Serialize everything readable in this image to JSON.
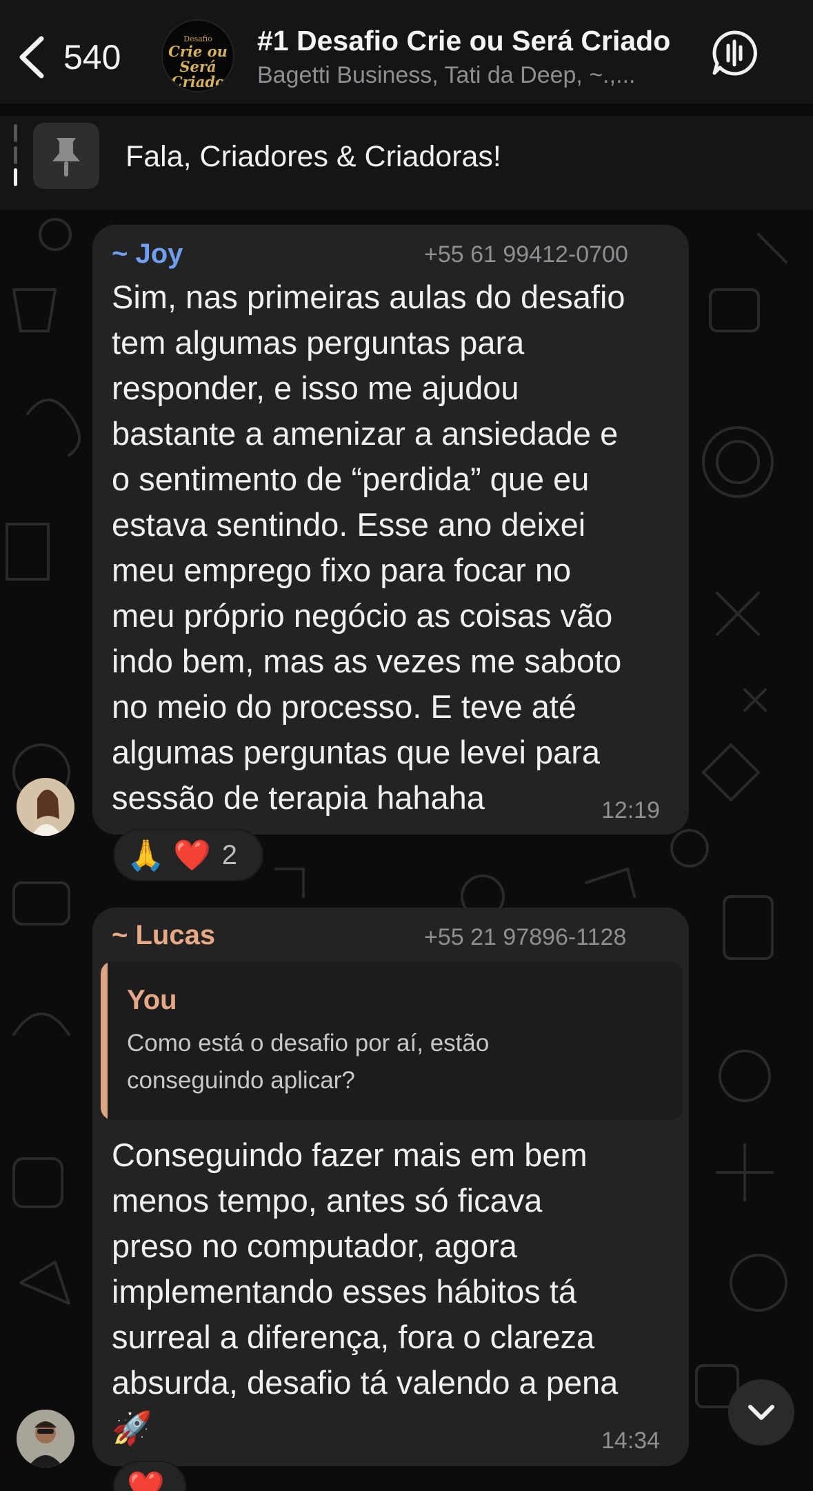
{
  "header": {
    "back_count": "540",
    "title": "#1 Desafio Crie ou Será Criado",
    "subtitle": "Bagetti Business, Tati da Deep, ~.,...",
    "avatar_logo_small": "Desafio",
    "avatar_logo_main": "Crie ou Será Criado"
  },
  "pinned": {
    "text": "Fala, Criadores & Criadoras!"
  },
  "messages": [
    {
      "sender": "~ Joy",
      "phone": "+55 61 99412-0700",
      "lines": [
        "Sim, nas primeiras aulas do desafio",
        "tem algumas perguntas para",
        "responder, e isso me ajudou",
        "bastante a amenizar a ansiedade e",
        "o sentimento de “perdida” que eu",
        "estava sentindo. Esse ano deixei",
        "meu emprego fixo para focar no",
        "meu próprio negócio as coisas vão",
        "indo bem, mas as vezes me saboto",
        "no meio do processo. E teve até",
        "algumas perguntas que levei para",
        "sessão de terapia hahaha"
      ],
      "time": "12:19",
      "reactions": {
        "emojis": "🙏 ❤️",
        "count": "2"
      }
    },
    {
      "sender": "~ Lucas",
      "phone": "+55 21 97896-1128",
      "reply": {
        "name": "You",
        "text_line1": "Como está o desafio por aí, estão",
        "text_line2": "conseguindo aplicar?"
      },
      "lines": [
        "Conseguindo fazer mais em bem",
        "menos tempo, antes só ficava",
        "preso no computador, agora",
        "implementando esses hábitos tá",
        "surreal a diferença, fora o clareza",
        "absurda, desafio tá valendo a pena",
        "🚀"
      ],
      "time": "14:34",
      "reactions": {
        "emojis": "❤️"
      }
    }
  ],
  "colors": {
    "joy_name": "#6f9ff0",
    "lucas_name": "#e8a986",
    "bubble": "#232323",
    "background": "#0c0c0c"
  },
  "icons": [
    "chevron-left-icon",
    "voice-chat-icon",
    "pin-icon",
    "chevron-down-icon"
  ]
}
